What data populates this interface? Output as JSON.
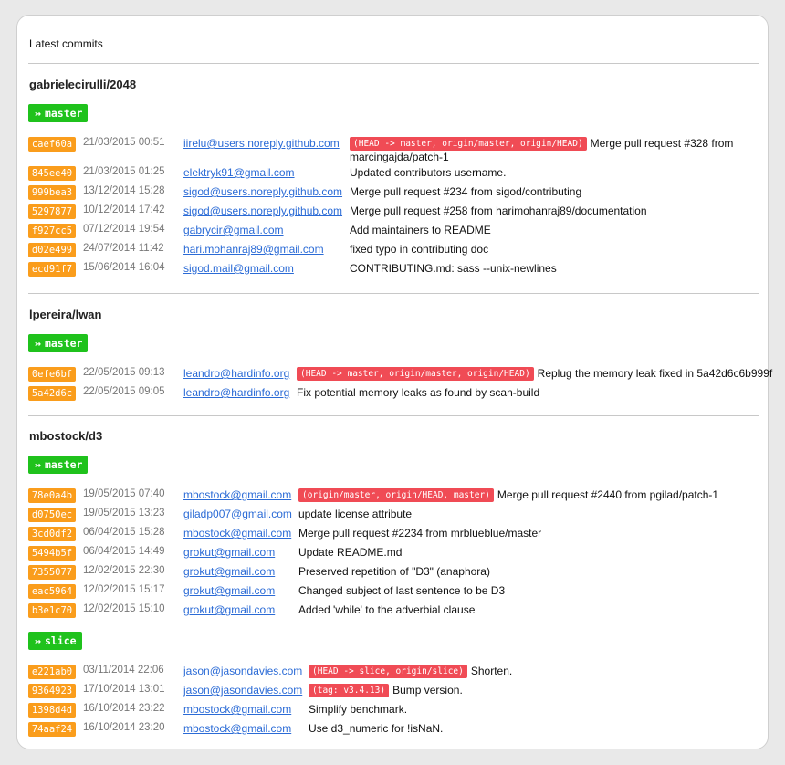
{
  "header": {
    "title": "Latest commits"
  },
  "repos": [
    {
      "name": "gabrielecirulli/2048",
      "branches": [
        {
          "name": "master",
          "commits": [
            {
              "sha": "caef60a",
              "date": "21/03/2015 00:51",
              "email": "iirelu@users.noreply.github.com",
              "ref": "(HEAD -> master, origin/master, origin/HEAD)",
              "message": "Merge pull request #328 from marcingajda/patch-1"
            },
            {
              "sha": "845ee40",
              "date": "21/03/2015 01:25",
              "email": "elektryk91@gmail.com",
              "message": "Updated contributors username."
            },
            {
              "sha": "999bea3",
              "date": "13/12/2014 15:28",
              "email": "sigod@users.noreply.github.com",
              "message": "Merge pull request #234 from sigod/contributing"
            },
            {
              "sha": "5297877",
              "date": "10/12/2014 17:42",
              "email": "sigod@users.noreply.github.com",
              "message": "Merge pull request #258 from harimohanraj89/documentation"
            },
            {
              "sha": "f927cc5",
              "date": "07/12/2014 19:54",
              "email": "gabrycir@gmail.com",
              "message": "Add maintainers to README"
            },
            {
              "sha": "d02e499",
              "date": "24/07/2014 11:42",
              "email": "hari.mohanraj89@gmail.com",
              "message": "fixed typo in contributing doc"
            },
            {
              "sha": "ecd91f7",
              "date": "15/06/2014 16:04",
              "email": "sigod.mail@gmail.com",
              "message": "CONTRIBUTING.md: sass --unix-newlines"
            }
          ]
        }
      ]
    },
    {
      "name": "lpereira/lwan",
      "branches": [
        {
          "name": "master",
          "commits": [
            {
              "sha": "0efe6bf",
              "date": "22/05/2015 09:13",
              "email": "leandro@hardinfo.org",
              "ref": "(HEAD -> master, origin/master, origin/HEAD)",
              "message": "Replug the memory leak fixed in 5a42d6c6b999f"
            },
            {
              "sha": "5a42d6c",
              "date": "22/05/2015 09:05",
              "email": "leandro@hardinfo.org",
              "message": "Fix potential memory leaks as found by scan-build"
            }
          ]
        }
      ]
    },
    {
      "name": "mbostock/d3",
      "branches": [
        {
          "name": "master",
          "commits": [
            {
              "sha": "78e0a4b",
              "date": "19/05/2015 07:40",
              "email": "mbostock@gmail.com",
              "ref": "(origin/master, origin/HEAD, master)",
              "message": "Merge pull request #2440 from pgilad/patch-1"
            },
            {
              "sha": "d0750ec",
              "date": "19/05/2015 13:23",
              "email": "giladp007@gmail.com",
              "message": "update license attribute"
            },
            {
              "sha": "3cd0df2",
              "date": "06/04/2015 15:28",
              "email": "mbostock@gmail.com",
              "message": "Merge pull request #2234 from mrblueblue/master"
            },
            {
              "sha": "5494b5f",
              "date": "06/04/2015 14:49",
              "email": "grokut@gmail.com",
              "message": "Update README.md"
            },
            {
              "sha": "7355077",
              "date": "12/02/2015 22:30",
              "email": "grokut@gmail.com",
              "message": "Preserved repetition of \"D3\" (anaphora)"
            },
            {
              "sha": "eac5964",
              "date": "12/02/2015 15:17",
              "email": "grokut@gmail.com",
              "message": "Changed subject of last sentence to be D3"
            },
            {
              "sha": "b3e1c70",
              "date": "12/02/2015 15:10",
              "email": "grokut@gmail.com",
              "message": "Added 'while' to the adverbial clause"
            }
          ]
        },
        {
          "name": "slice",
          "commits": [
            {
              "sha": "e221ab0",
              "date": "03/11/2014 22:06",
              "email": "jason@jasondavies.com",
              "ref": "(HEAD -> slice, origin/slice)",
              "message": "Shorten."
            },
            {
              "sha": "9364923",
              "date": "17/10/2014 13:01",
              "email": "jason@jasondavies.com",
              "ref": "(tag: v3.4.13)",
              "message": "Bump version."
            },
            {
              "sha": "1398d4d",
              "date": "16/10/2014 23:22",
              "email": "mbostock@gmail.com",
              "message": "Simplify benchmark."
            },
            {
              "sha": "74aaf24",
              "date": "16/10/2014 23:20",
              "email": "mbostock@gmail.com",
              "message": "Use d3_numeric for !isNaN."
            }
          ]
        }
      ]
    }
  ]
}
